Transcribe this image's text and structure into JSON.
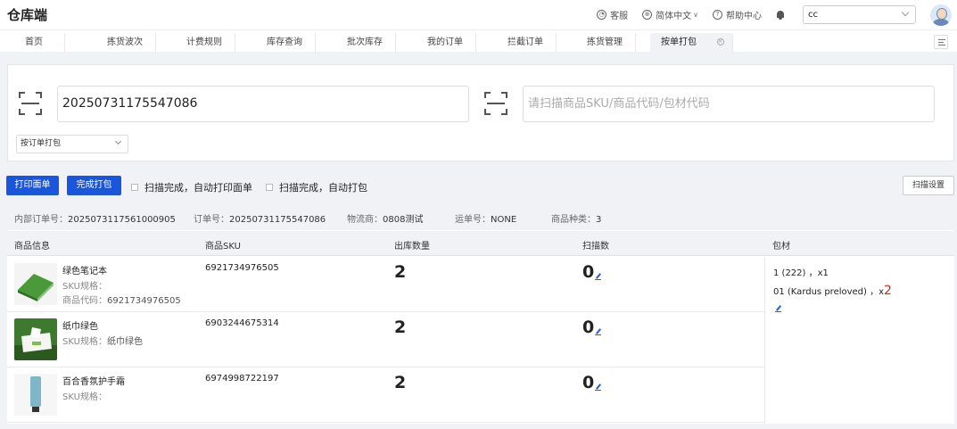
{
  "app": {
    "title": "仓库端"
  },
  "topbar": {
    "service": "客服",
    "language": "简体中文",
    "help": "帮助中心",
    "user": "cc"
  },
  "tabs": [
    {
      "label": "首页"
    },
    {
      "label": "拣货波次"
    },
    {
      "label": "计费规则"
    },
    {
      "label": "库存查询"
    },
    {
      "label": "批次库存"
    },
    {
      "label": "我的订单"
    },
    {
      "label": "拦截订单"
    },
    {
      "label": "拣货管理"
    },
    {
      "label": "按单打包",
      "active": true
    }
  ],
  "scan": {
    "order_value": "20250731175547086",
    "sku_placeholder": "请扫描商品SKU/商品代码/包材代码",
    "mode": "按订单打包"
  },
  "actions": {
    "print_label": "打印面单",
    "finish_pack": "完成打包",
    "auto_print": "扫描完成，自动打印面单",
    "auto_pack": "扫描完成，自动打包",
    "scan_settings": "扫描设置"
  },
  "order_info": {
    "internal_no_label": "内部订单号：",
    "internal_no": "2025073117561000905",
    "order_no_label": "订单号：",
    "order_no": "20250731175547086",
    "carrier_label": "物流商：",
    "carrier": "0808测试",
    "tracking_label": "运单号：",
    "tracking": "NONE",
    "kinds_label": "商品种类：",
    "kinds": "3"
  },
  "table": {
    "headers": {
      "product": "商品信息",
      "sku": "商品SKU",
      "qty": "出库数量",
      "scanned": "扫描数",
      "packing": "包材"
    },
    "spec_label": "SKU规格：",
    "code_label": "商品代码：",
    "rows": [
      {
        "name": "绿色笔记本",
        "spec": "",
        "code": "6921734976505",
        "sku": "6921734976505",
        "qty": "2",
        "scanned": "0"
      },
      {
        "name": "纸巾绿色",
        "spec": "纸巾绿色",
        "sku": "6903244675314",
        "qty": "2",
        "scanned": "0"
      },
      {
        "name": "百合香氛护手霜",
        "spec": "",
        "sku": "6974998722197",
        "qty": "2",
        "scanned": "0"
      }
    ],
    "packing": [
      {
        "text": "1 (222) ，x1",
        "qty": ""
      },
      {
        "text": "01 (Kardus preloved) ，x",
        "qty": "2"
      }
    ]
  }
}
